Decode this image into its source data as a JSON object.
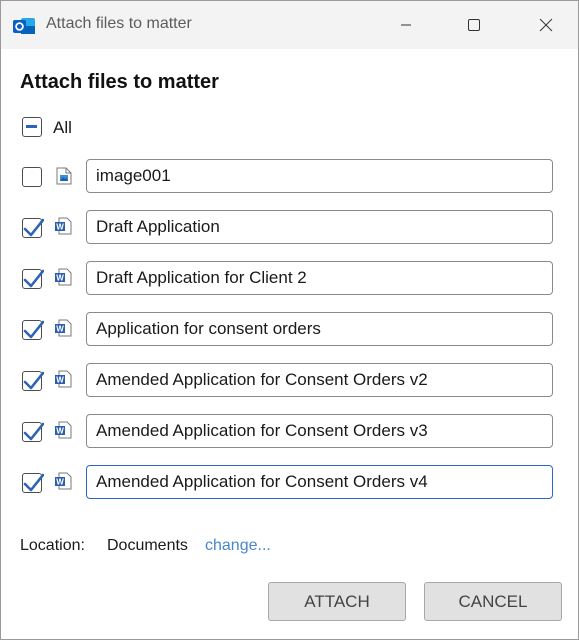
{
  "window": {
    "title": "Attach files to matter",
    "app_icon": "outlook-icon",
    "controls": [
      "minimize-icon",
      "maximize-icon",
      "close-icon"
    ]
  },
  "dialog": {
    "heading": "Attach files to matter",
    "select_all": {
      "label": "All",
      "state": "indeterminate"
    },
    "files": [
      {
        "name": "image001",
        "checked": false,
        "icon": "image-file-icon"
      },
      {
        "name": "Draft Application",
        "checked": true,
        "icon": "word-doc-icon"
      },
      {
        "name": "Draft Application for Client 2",
        "checked": true,
        "icon": "word-doc-icon"
      },
      {
        "name": "Application for consent orders",
        "checked": true,
        "icon": "word-doc-icon"
      },
      {
        "name": "Amended Application for Consent Orders v2",
        "checked": true,
        "icon": "word-doc-icon"
      },
      {
        "name": "Amended Application for Consent Orders v3",
        "checked": true,
        "icon": "word-doc-icon"
      },
      {
        "name": "Amended Application for Consent Orders v4",
        "checked": true,
        "icon": "word-doc-icon"
      }
    ],
    "location": {
      "label": "Location:",
      "value": "Documents",
      "change_link": "change..."
    },
    "buttons": {
      "attach": "ATTACH",
      "cancel": "CANCEL"
    }
  },
  "colors": {
    "accent": "#2b67c6",
    "link": "#4a87c9",
    "button_bg": "#e1e1e1",
    "titlebar_bg": "#f3f3f3"
  }
}
